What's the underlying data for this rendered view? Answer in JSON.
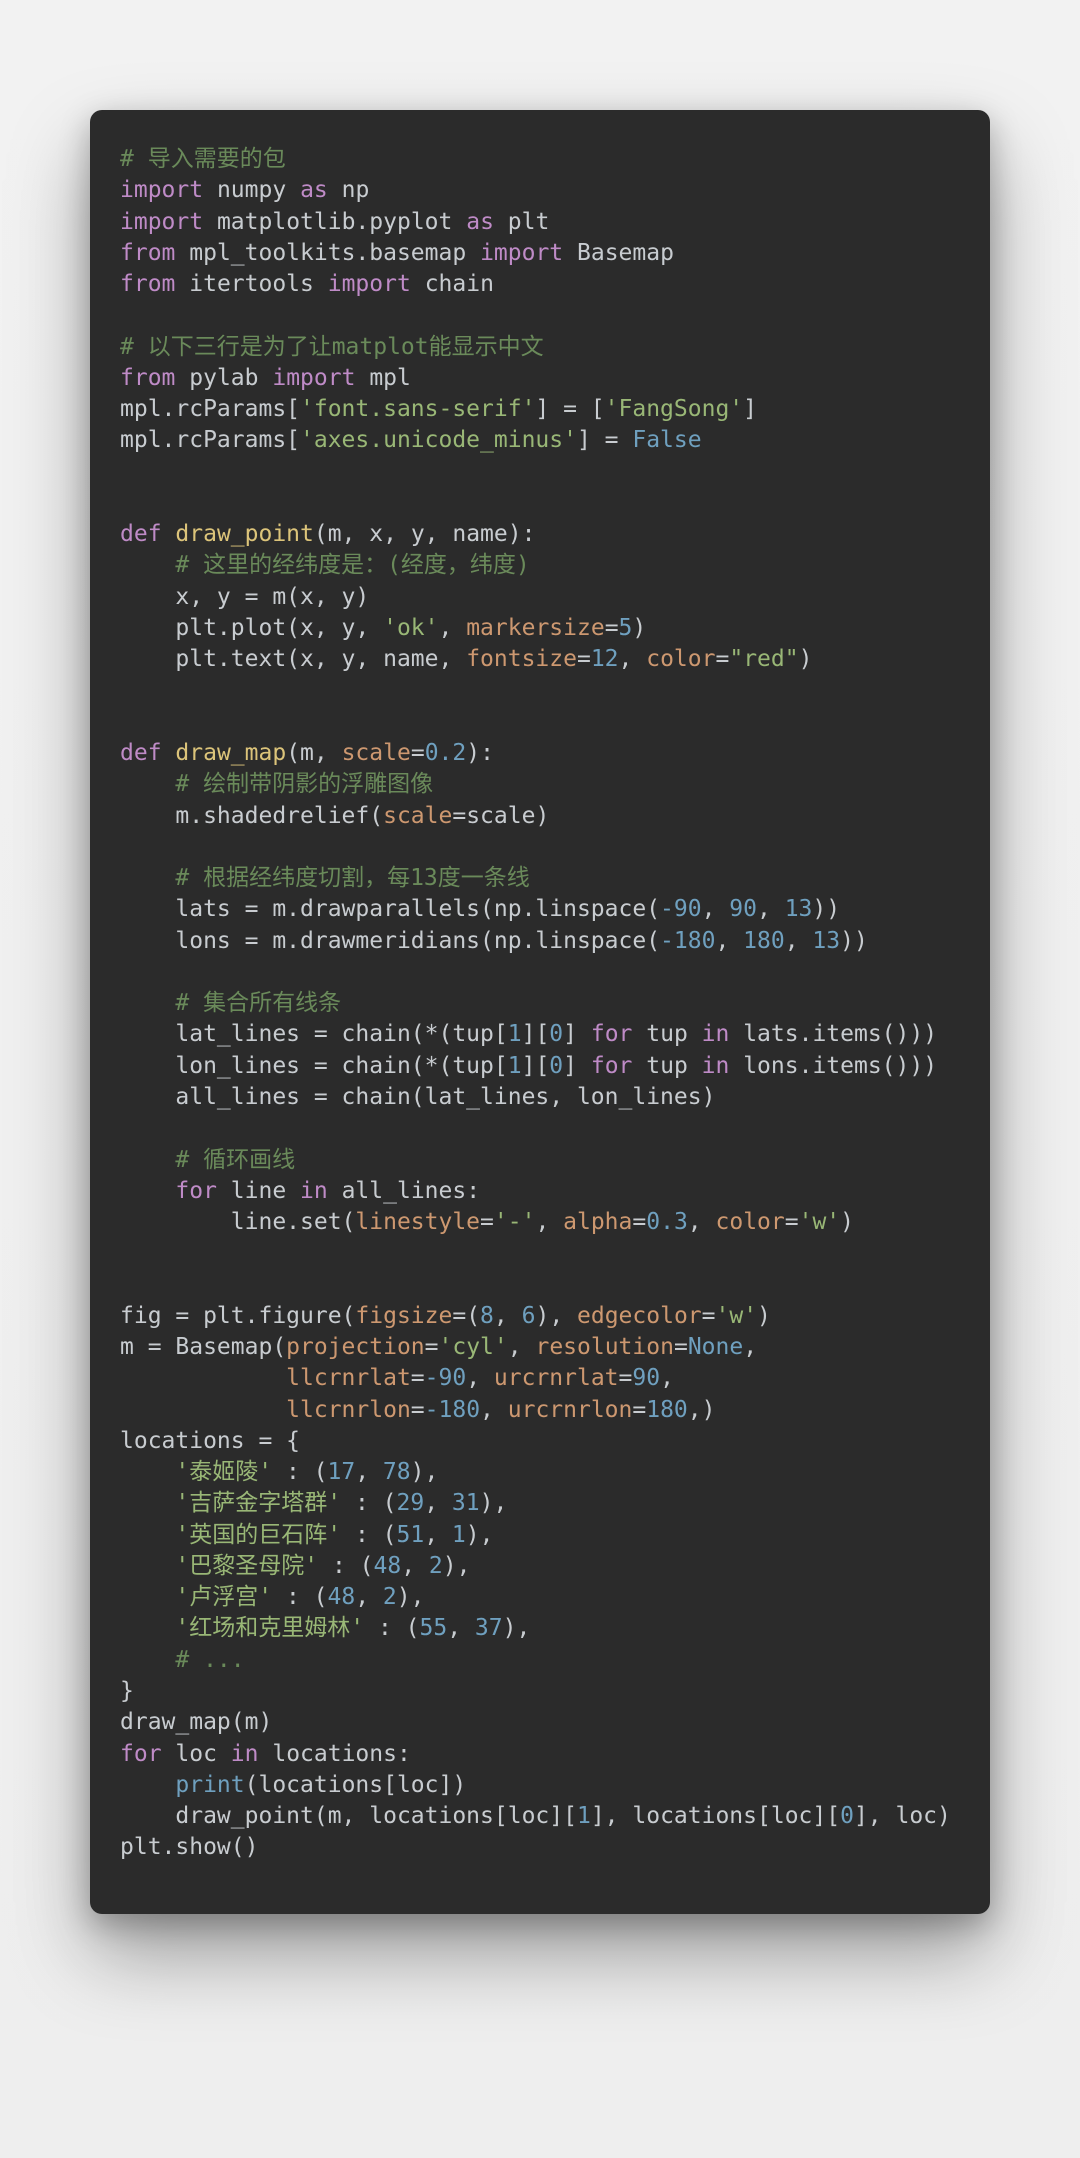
{
  "code": {
    "l01_comment": "# 导入需要的包",
    "l02_kw_import": "import",
    "l02_id_numpy": "numpy",
    "l02_kw_as": "as",
    "l02_id_np": "np",
    "l03_kw_import": "import",
    "l03_id_mpl": "matplotlib.pyplot",
    "l03_kw_as": "as",
    "l03_id_plt": "plt",
    "l04_kw_from": "from",
    "l04_id_tk": "mpl_toolkits.basemap",
    "l04_kw_import": "import",
    "l04_id_bm": "Basemap",
    "l05_kw_from": "from",
    "l05_id_it": "itertools",
    "l05_kw_import": "import",
    "l05_id_chain": "chain",
    "l07_comment": "# 以下三行是为了让matplot能显示中文",
    "l08_kw_from": "from",
    "l08_id_pylab": "pylab",
    "l08_kw_import": "import",
    "l08_id_mpl": "mpl",
    "l09_a": "mpl.rcParams[",
    "l09_s1": "'font.sans-serif'",
    "l09_mid": "] = [",
    "l09_s2": "'FangSong'",
    "l09_end": "]",
    "l10_a": "mpl.rcParams[",
    "l10_s1": "'axes.unicode_minus'",
    "l10_mid": "] = ",
    "l10_false": "False",
    "l13_def": "def",
    "l13_name": "draw_point",
    "l13_sig": "(m, x, y, name):",
    "l14_comment": "# 这里的经纬度是：(经度，纬度)",
    "l15_body": "x, y = m(x, y)",
    "l16_a": "plt.plot(x, y, ",
    "l16_s": "'ok'",
    "l16_b": ", ",
    "l16_kw": "markersize",
    "l16_c": "=",
    "l16_n": "5",
    "l16_end": ")",
    "l17_a": "plt.text(x, y, name, ",
    "l17_kw1": "fontsize",
    "l17_eq1": "=",
    "l17_n1": "12",
    "l17_c1": ", ",
    "l17_kw2": "color",
    "l17_eq2": "=",
    "l17_s2": "\"red\"",
    "l17_end": ")",
    "l20_def": "def",
    "l20_name": "draw_map",
    "l20_sig_a": "(m, ",
    "l20_kw": "scale",
    "l20_eq": "=",
    "l20_n": "0.2",
    "l20_end": "):",
    "l21_comment": "# 绘制带阴影的浮雕图像",
    "l22_a": "m.shadedrelief(",
    "l22_kw": "scale",
    "l22_eq": "=scale)",
    "l24_comment": "# 根据经纬度切割，每13度一条线",
    "l25_a": "lats = m.drawparallels(np.linspace(",
    "l25_n1": "-90",
    "l25_c1": ", ",
    "l25_n2": "90",
    "l25_c2": ", ",
    "l25_n3": "13",
    "l25_end": "))",
    "l26_a": "lons = m.drawmeridians(np.linspace(",
    "l26_n1": "-180",
    "l26_c1": ", ",
    "l26_n2": "180",
    "l26_c2": ", ",
    "l26_n3": "13",
    "l26_end": "))",
    "l28_comment": "# 集合所有线条",
    "l29_a": "lat_lines = chain(*(tup[",
    "l29_n1": "1",
    "l29_mid1": "][",
    "l29_n2": "0",
    "l29_mid2": "] ",
    "l29_for": "for",
    "l29_sp1": " tup ",
    "l29_in": "in",
    "l29_end": " lats.items()))",
    "l30_a": "lon_lines = chain(*(tup[",
    "l30_n1": "1",
    "l30_mid1": "][",
    "l30_n2": "0",
    "l30_mid2": "] ",
    "l30_for": "for",
    "l30_sp1": " tup ",
    "l30_in": "in",
    "l30_end": " lons.items()))",
    "l31_body": "all_lines = chain(lat_lines, lon_lines)",
    "l33_comment": "# 循环画线",
    "l34_for": "for",
    "l34_mid": " line ",
    "l34_in": "in",
    "l34_end": " all_lines:",
    "l35_a": "line.set(",
    "l35_kw1": "linestyle",
    "l35_eq1": "=",
    "l35_s1": "'-'",
    "l35_c1": ", ",
    "l35_kw2": "alpha",
    "l35_eq2": "=",
    "l35_n2": "0.3",
    "l35_c2": ", ",
    "l35_kw3": "color",
    "l35_eq3": "=",
    "l35_s3": "'w'",
    "l35_end": ")",
    "l38_a": "fig = plt.figure(",
    "l38_kw1": "figsize",
    "l38_eq1": "=(",
    "l38_n1": "8",
    "l38_c1": ", ",
    "l38_n2": "6",
    "l38_c2": "), ",
    "l38_kw2": "edgecolor",
    "l38_eq2": "=",
    "l38_s2": "'w'",
    "l38_end": ")",
    "l39_a": "m = Basemap(",
    "l39_kw1": "projection",
    "l39_eq1": "=",
    "l39_s1": "'cyl'",
    "l39_c1": ", ",
    "l39_kw2": "resolution",
    "l39_eq2": "=",
    "l39_none": "None",
    "l39_end": ",",
    "l40_pad": "            ",
    "l40_kw1": "llcrnrlat",
    "l40_eq1": "=",
    "l40_n1": "-90",
    "l40_c1": ", ",
    "l40_kw2": "urcrnrlat",
    "l40_eq2": "=",
    "l40_n2": "90",
    "l40_end": ",",
    "l41_pad": "            ",
    "l41_kw1": "llcrnrlon",
    "l41_eq1": "=",
    "l41_n1": "-180",
    "l41_c1": ", ",
    "l41_kw2": "urcrnrlon",
    "l41_eq2": "=",
    "l41_n2": "180",
    "l41_end": ",)",
    "l42_body": "locations = {",
    "l43_s": "'泰姬陵'",
    "l43_mid": " : (",
    "l43_n1": "17",
    "l43_c": ", ",
    "l43_n2": "78",
    "l43_end": "),",
    "l44_s": "'吉萨金字塔群'",
    "l44_mid": " : (",
    "l44_n1": "29",
    "l44_c": ", ",
    "l44_n2": "31",
    "l44_end": "),",
    "l45_s": "'英国的巨石阵'",
    "l45_mid": " : (",
    "l45_n1": "51",
    "l45_c": ", ",
    "l45_n2": "1",
    "l45_end": "),",
    "l46_s": "'巴黎圣母院'",
    "l46_mid": " : (",
    "l46_n1": "48",
    "l46_c": ", ",
    "l46_n2": "2",
    "l46_end": "),",
    "l47_s": "'卢浮宫'",
    "l47_mid": " : (",
    "l47_n1": "48",
    "l47_c": ", ",
    "l47_n2": "2",
    "l47_end": "),",
    "l48_s": "'红场和克里姆林'",
    "l48_mid": " : (",
    "l48_n1": "55",
    "l48_c": ", ",
    "l48_n2": "37",
    "l48_end": "),",
    "l49_comment": "# ...",
    "l50_body": "}",
    "l51_body": "draw_map(m)",
    "l52_for": "for",
    "l52_mid": " loc ",
    "l52_in": "in",
    "l52_end": " locations:",
    "l53_a": "print",
    "l53_end": "(locations[loc])",
    "l54_body": "draw_point(m, locations[loc][",
    "l54_n1": "1",
    "l54_mid": "], locations[loc][",
    "l54_n2": "0",
    "l54_end": "], loc)",
    "l55_body": "plt.show()"
  }
}
